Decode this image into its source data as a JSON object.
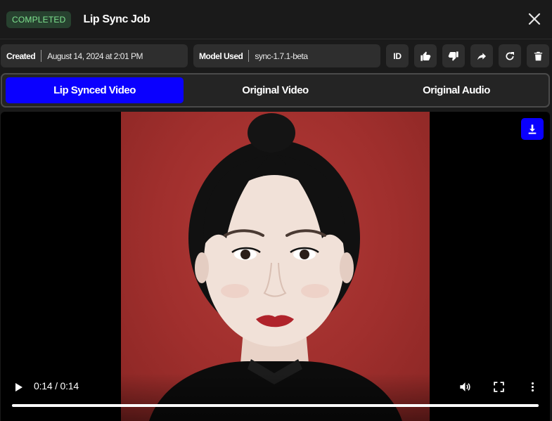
{
  "header": {
    "status": "COMPLETED",
    "title": "Lip Sync Job"
  },
  "meta": {
    "created_label": "Created",
    "created_value": "August 14, 2024 at 2:01 PM",
    "model_label": "Model Used",
    "model_value": "sync-1.7.1-beta",
    "id_label": "ID"
  },
  "tabs": [
    {
      "label": "Lip Synced Video",
      "active": true
    },
    {
      "label": "Original Video",
      "active": false
    },
    {
      "label": "Original Audio",
      "active": false
    }
  ],
  "player": {
    "time_display": "0:14 / 0:14",
    "progress": 1.0
  },
  "colors": {
    "accent": "#0a00ff",
    "status_bg": "#27412f",
    "status_text": "#7ee28f",
    "portrait_background": "#a8302e"
  },
  "icons": [
    "close-icon",
    "thumbs-up-icon",
    "thumbs-down-icon",
    "share-icon",
    "refresh-icon",
    "trash-icon",
    "download-icon",
    "play-icon",
    "volume-icon",
    "fullscreen-icon",
    "more-vert-icon"
  ]
}
